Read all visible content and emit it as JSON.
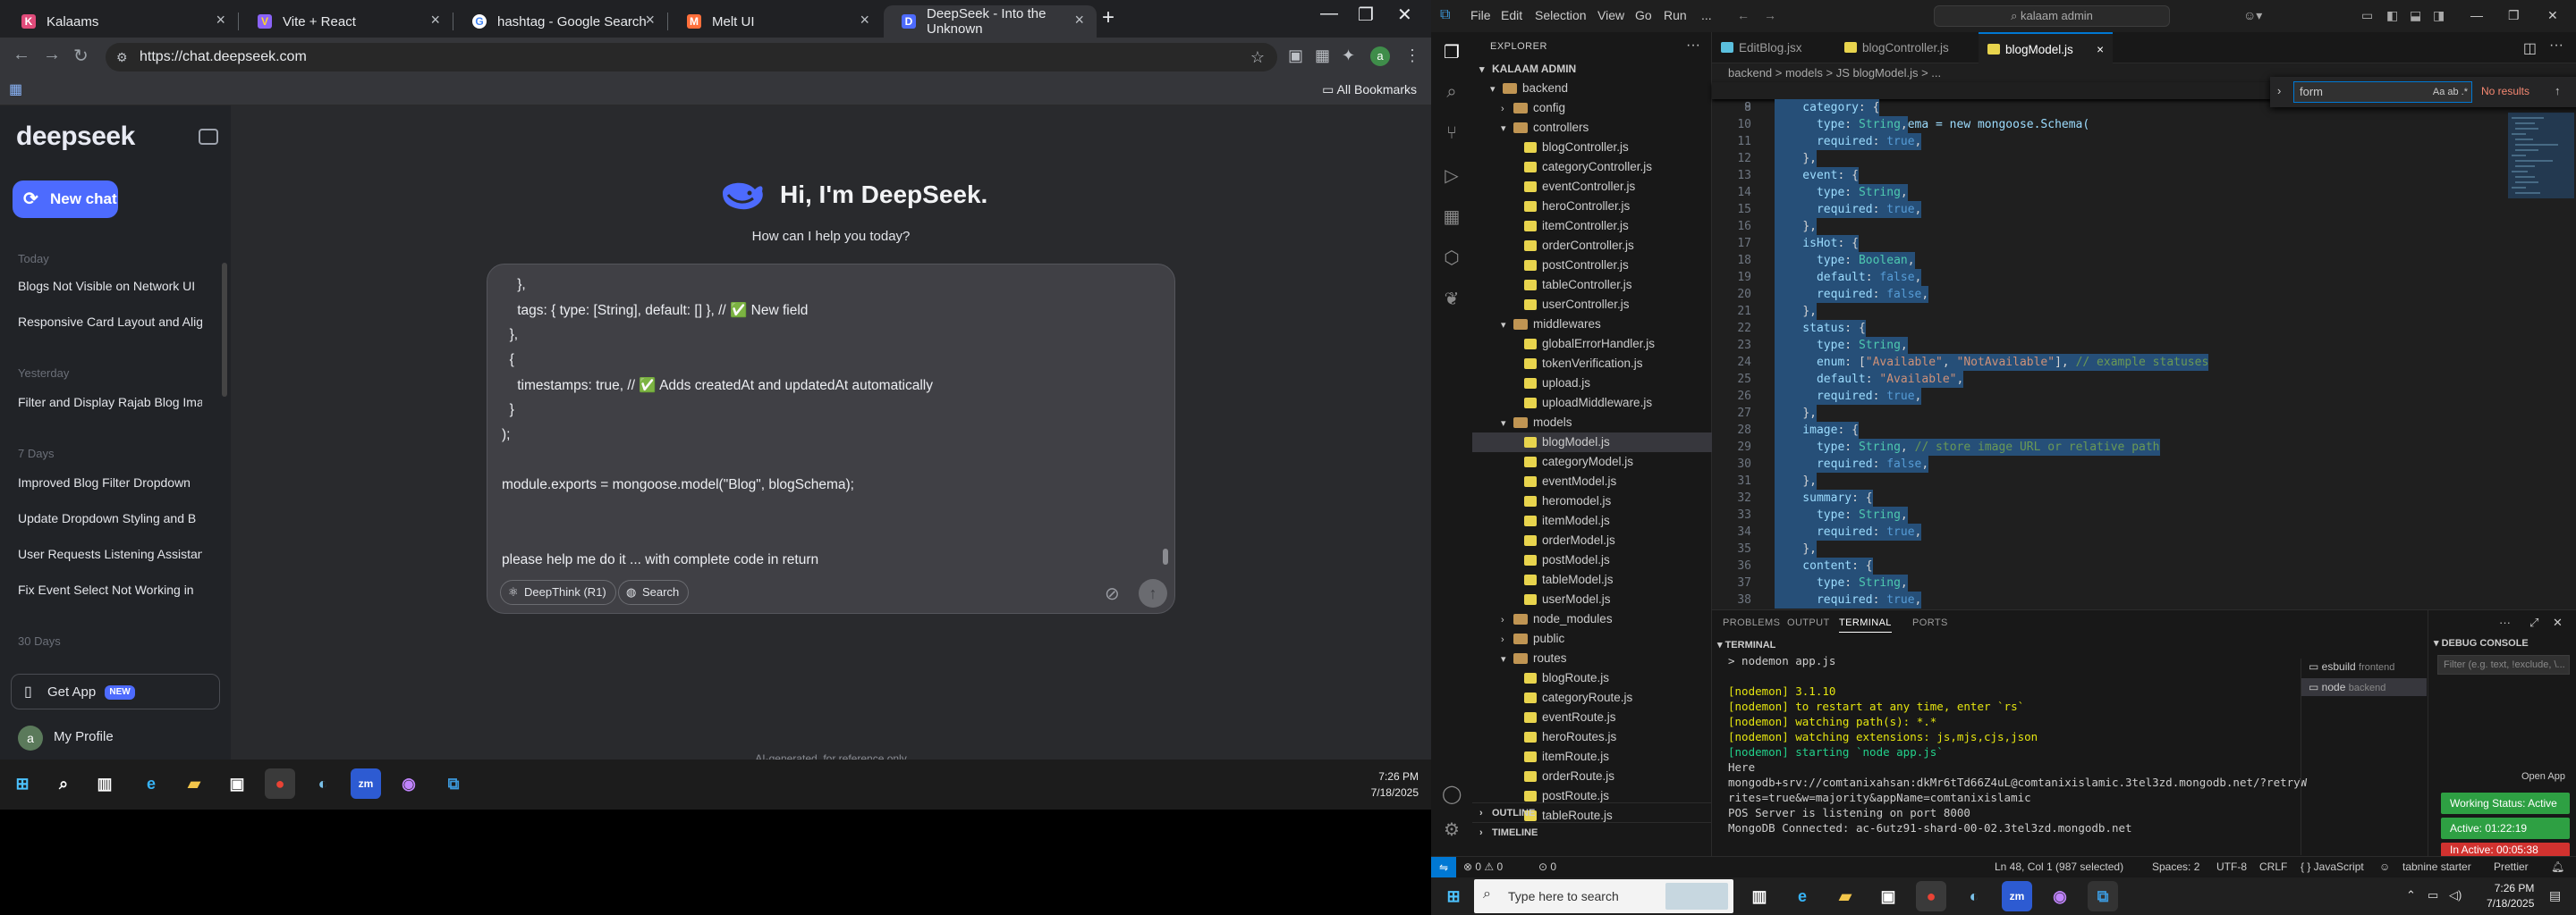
{
  "chrome": {
    "tabs": [
      {
        "title": "Kalaams",
        "icon": "K",
        "color": "#e04b7a"
      },
      {
        "title": "Vite + React",
        "icon": "V",
        "color": "#8a63f7"
      },
      {
        "title": "hashtag - Google Search",
        "icon": "G",
        "color": "#4285f4"
      },
      {
        "title": "Melt UI",
        "icon": "M",
        "color": "#ff6f3b"
      },
      {
        "title": "DeepSeek - Into the Unknown",
        "icon": "D",
        "color": "#4d6bfe"
      }
    ],
    "url": "https://chat.deepseek.com",
    "all_bookmarks": "All Bookmarks"
  },
  "deepseek": {
    "logo": "deepseek",
    "new_chat": "New chat",
    "sections": [
      {
        "label": "Today",
        "items": [
          "Blogs Not Visible on Network UI",
          "Responsive Card Layout and Alig"
        ]
      },
      {
        "label": "Yesterday",
        "items": [
          "Filter and Display Rajab Blog Ima"
        ]
      },
      {
        "label": "7 Days",
        "items": [
          "Improved Blog Filter Dropdown",
          "Update Dropdown Styling and B",
          "User Requests Listening Assistan",
          "Fix Event Select Not Working in"
        ]
      },
      {
        "label": "30 Days",
        "items": []
      }
    ],
    "get_app": "Get App",
    "new_badge": "NEW",
    "profile_initial": "a",
    "profile": "My Profile",
    "greeting": "Hi, I'm DeepSeek.",
    "subtitle": "How can I help you today?",
    "input_lines": [
      "    },",
      "    tags: { type: [String], default: [] }, // ✅ New field",
      "  },",
      "  {",
      "    timestamps: true, // ✅ Adds createdAt and updatedAt automatically",
      "  }",
      ");",
      "",
      "module.exports = mongoose.model(\"Blog\", blogSchema);",
      "",
      "",
      "please help me do it ... with complete code in return"
    ],
    "deepthink": "DeepThink (R1)",
    "search": "Search",
    "footer": "AI-generated, for reference only"
  },
  "taskbar_left": {
    "time": "7:26 PM",
    "date": "7/18/2025"
  },
  "vscode": {
    "menu": [
      "File",
      "Edit",
      "Selection",
      "View",
      "Go",
      "Run",
      "..."
    ],
    "search": "kalaam admin",
    "explorer_title": "EXPLORER",
    "root": "KALAAM ADMIN",
    "tree": [
      {
        "name": "backend",
        "type": "folder",
        "depth": 1,
        "open": true
      },
      {
        "name": "config",
        "type": "folder",
        "depth": 2,
        "open": false
      },
      {
        "name": "controllers",
        "type": "folder",
        "depth": 2,
        "open": true
      },
      {
        "name": "blogController.js",
        "type": "js",
        "depth": 3
      },
      {
        "name": "categoryController.js",
        "type": "js",
        "depth": 3
      },
      {
        "name": "eventController.js",
        "type": "js",
        "depth": 3
      },
      {
        "name": "heroController.js",
        "type": "js",
        "depth": 3
      },
      {
        "name": "itemController.js",
        "type": "js",
        "depth": 3
      },
      {
        "name": "orderController.js",
        "type": "js",
        "depth": 3
      },
      {
        "name": "postController.js",
        "type": "js",
        "depth": 3
      },
      {
        "name": "tableController.js",
        "type": "js",
        "depth": 3
      },
      {
        "name": "userController.js",
        "type": "js",
        "depth": 3
      },
      {
        "name": "middlewares",
        "type": "folder",
        "depth": 2,
        "open": true
      },
      {
        "name": "globalErrorHandler.js",
        "type": "js",
        "depth": 3
      },
      {
        "name": "tokenVerification.js",
        "type": "js",
        "depth": 3
      },
      {
        "name": "upload.js",
        "type": "js",
        "depth": 3
      },
      {
        "name": "uploadMiddleware.js",
        "type": "js",
        "depth": 3
      },
      {
        "name": "models",
        "type": "folder",
        "depth": 2,
        "open": true
      },
      {
        "name": "blogModel.js",
        "type": "js",
        "depth": 3,
        "selected": true
      },
      {
        "name": "categoryModel.js",
        "type": "js",
        "depth": 3
      },
      {
        "name": "eventModel.js",
        "type": "js",
        "depth": 3
      },
      {
        "name": "heromodel.js",
        "type": "js",
        "depth": 3
      },
      {
        "name": "itemModel.js",
        "type": "js",
        "depth": 3
      },
      {
        "name": "orderModel.js",
        "type": "js",
        "depth": 3
      },
      {
        "name": "postModel.js",
        "type": "js",
        "depth": 3
      },
      {
        "name": "tableModel.js",
        "type": "js",
        "depth": 3
      },
      {
        "name": "userModel.js",
        "type": "js",
        "depth": 3
      },
      {
        "name": "node_modules",
        "type": "folder",
        "depth": 2,
        "open": false
      },
      {
        "name": "public",
        "type": "folder",
        "depth": 2,
        "open": false
      },
      {
        "name": "routes",
        "type": "folder",
        "depth": 2,
        "open": true
      },
      {
        "name": "blogRoute.js",
        "type": "js",
        "depth": 3
      },
      {
        "name": "categoryRoute.js",
        "type": "js",
        "depth": 3
      },
      {
        "name": "eventRoute.js",
        "type": "js",
        "depth": 3
      },
      {
        "name": "heroRoutes.js",
        "type": "js",
        "depth": 3
      },
      {
        "name": "itemRoute.js",
        "type": "js",
        "depth": 3
      },
      {
        "name": "orderRoute.js",
        "type": "js",
        "depth": 3
      },
      {
        "name": "postRoute.js",
        "type": "js",
        "depth": 3
      },
      {
        "name": "tableRoute.js",
        "type": "js",
        "depth": 3
      }
    ],
    "outline": "OUTLINE",
    "timeline": "TIMELINE",
    "tabs": [
      "EditBlog.jsx",
      "blogController.js",
      "blogModel.js"
    ],
    "breadcrumb": "backend > models > JS blogModel.js > ...",
    "sticky_line": "const blogSchema = new mongoose.Schema(",
    "find": {
      "query": "form",
      "result": "No results"
    },
    "code_start": 9,
    "code": [
      "    category: {",
      "      type: String,",
      "      required: true,",
      "    },",
      "    event: {",
      "      type: String,",
      "      required: true,",
      "    },",
      "    isHot: {",
      "      type: Boolean,",
      "      default: false,",
      "      required: false,",
      "    },",
      "    status: {",
      "      type: String,",
      "      enum: [\"Available\", \"NotAvailable\"], // example statuses",
      "      default: \"Available\",",
      "      required: true,",
      "    },",
      "    image: {",
      "      type: String, // store image URL or relative path",
      "      required: false,",
      "    },",
      "    summary: {",
      "      type: String,",
      "      required: true,",
      "    },",
      "    content: {",
      "      type: String,",
      "      required: true,"
    ],
    "panel_tabs": [
      "PROBLEMS",
      "OUTPUT",
      "TERMINAL",
      "PORTS"
    ],
    "terminal_title": "TERMINAL",
    "terminal_lines": [
      "> nodemon app.js",
      "",
      "[nodemon] 3.1.10",
      "[nodemon] to restart at any time, enter `rs`",
      "[nodemon] watching path(s): *.*",
      "[nodemon] watching extensions: js,mjs,cjs,json",
      "[nodemon] starting `node app.js`",
      "Here",
      "mongodb+srv://comtanixahsan:dkMr6tTd66Z4uL@comtanixislamic.3tel3zd.mongodb.net/?retryW",
      "rites=true&w=majority&appName=comtanixislamic",
      "POS Server is listening on port 8000",
      "MongoDB Connected: ac-6utz91-shard-00-02.3tel3zd.mongodb.net"
    ],
    "terminals": [
      {
        "name": "esbuild",
        "label": "frontend"
      },
      {
        "name": "node",
        "label": "backend"
      }
    ],
    "debug_console": "DEBUG CONSOLE",
    "debug_filter": "Filter (e.g. text, !exclude, \\...",
    "open_app": "Open App",
    "working_status": "Working Status: Active",
    "active_time": "Active: 01:22:19",
    "inactive_time": "In Active: 00:05:38",
    "status": {
      "errors": "⊗ 0 ⚠ 0",
      "counts": "0",
      "position": "Ln 48, Col 1 (987 selected)",
      "spaces": "Spaces: 2",
      "encoding": "UTF-8",
      "eol": "CRLF",
      "lang": "{ } JavaScript",
      "tabnine": "tabnine starter",
      "prettier": "Prettier"
    }
  },
  "taskbar_right": {
    "search": "Type here to search",
    "time": "7:26 PM",
    "date": "7/18/2025"
  }
}
